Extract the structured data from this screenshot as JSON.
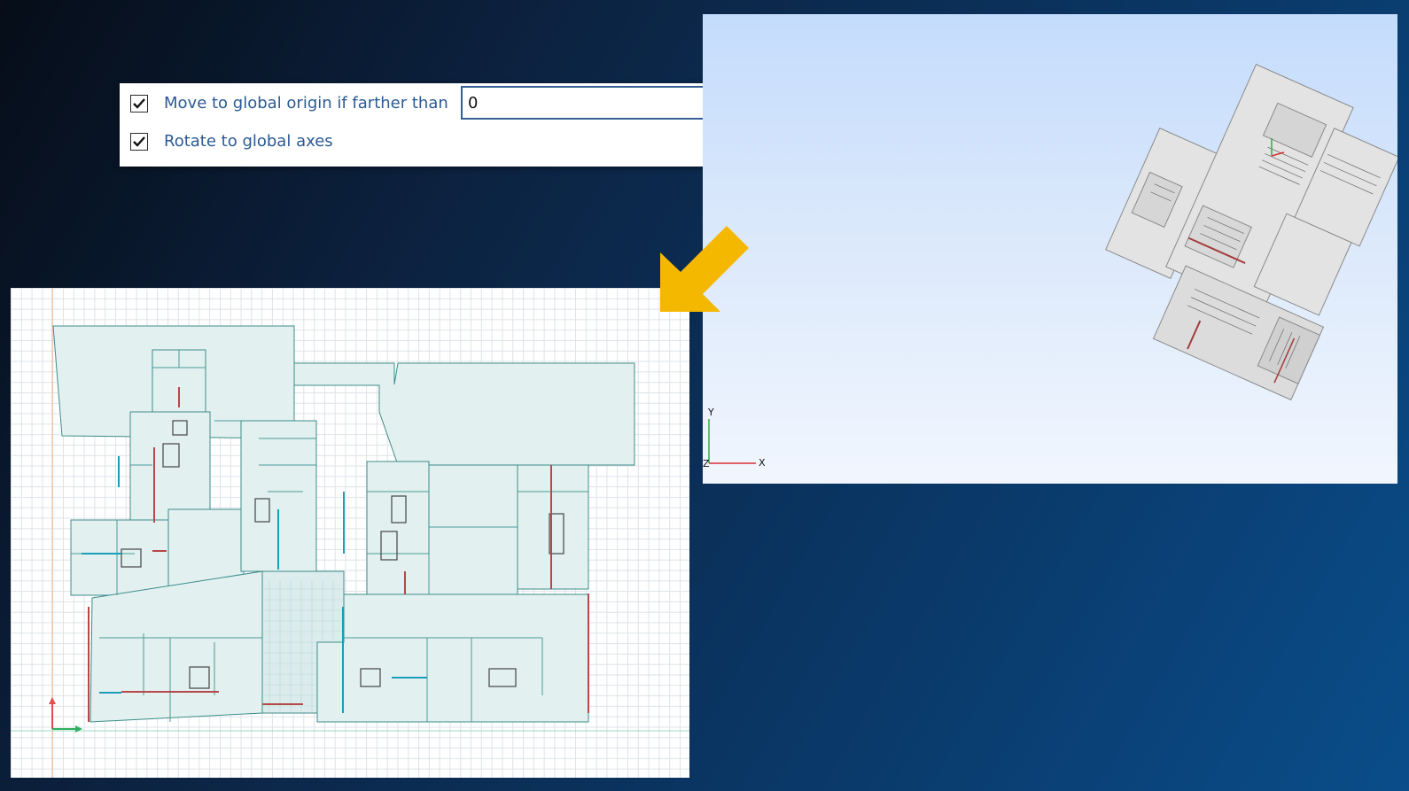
{
  "options": {
    "move_label": "Move to global origin if farther than",
    "move_checked": true,
    "distance_value": "0",
    "rotate_label": "Rotate to global axes",
    "rotate_checked": true
  },
  "viewport_3d": {
    "axis_y": "Y",
    "axis_x": "X",
    "axis_z": "Z"
  },
  "colors": {
    "arrow": "#f5b800",
    "plan_fill": "#e2f1f0",
    "plan_stroke": "#3c8c8a",
    "wall_red": "#b54848",
    "wall_cyan": "#1a9db8",
    "model_fill": "#e3e3e3"
  },
  "icons": {
    "checkbox": "check-icon",
    "arrow": "arrow-down-left-icon",
    "axes": "axis-triad-icon"
  }
}
